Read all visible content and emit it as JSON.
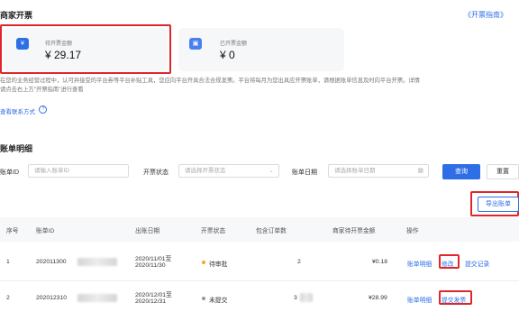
{
  "merchant_invoice": {
    "title": "商家开票",
    "guide_link": "《开票指南》",
    "pending": {
      "label": "待开票金额",
      "value": "¥ 29.17",
      "icon": "¥"
    },
    "issued": {
      "label": "已开票金额",
      "value": "¥ 0",
      "icon": "▣"
    }
  },
  "notice": {
    "line1": "在您的业务经营过程中，认可并接受的平台券等平台补贴工具，您应向平台开具合法合规发票。平台将每月为您出具应开票账单，请根据账单信息及时向平台开票。详情",
    "line2": "请点击右上方\"开票指南\"进行查看",
    "contact_link": "查看联系方式"
  },
  "bill_detail": {
    "title": "账单明细",
    "filters": {
      "bill_id_label": "账单ID",
      "bill_id_placeholder": "请输入账单ID",
      "status_label": "开票状态",
      "status_placeholder": "请选择开票状态",
      "date_label": "账单日期",
      "date_placeholder": "请选择账单日期"
    },
    "query_button": "查询",
    "reset_button": "重置",
    "export_button": "导出账单"
  },
  "table": {
    "columns": [
      "序号",
      "账单ID",
      "出账日期",
      "开票状态",
      "包含订单数",
      "商家待开票金额",
      "操作"
    ],
    "rows": [
      {
        "index": "1",
        "bill_id": "202011300",
        "date_line1": "2020/11/01至",
        "date_line2": "2020/11/30",
        "status": "待审批",
        "status_color": "#f5a623",
        "orders": "2",
        "amount": "¥0.18",
        "actions": [
          "账单明细",
          "修改",
          "提交记录"
        ]
      },
      {
        "index": "2",
        "bill_id": "202012310",
        "date_line1": "2020/12/01至",
        "date_line2": "2020/12/31",
        "status": "未提交",
        "status_color": "#999999",
        "orders": "3",
        "amount": "¥28.99",
        "actions": [
          "账单明细",
          "提交发票"
        ]
      }
    ]
  },
  "colors": {
    "accent": "#2f6fe6",
    "highlight": "#e0262b"
  }
}
